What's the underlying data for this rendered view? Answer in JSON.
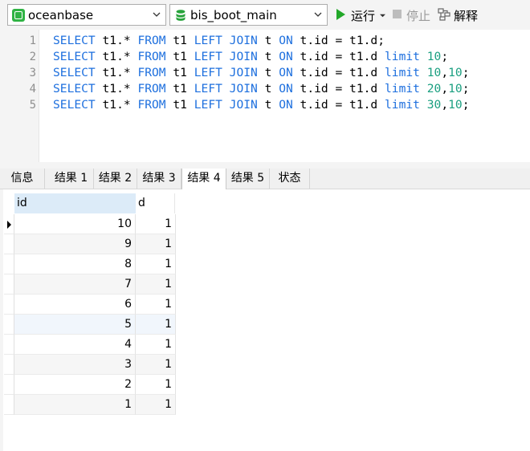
{
  "toolbar": {
    "connection": "oceanbase",
    "database": "bis_boot_main",
    "run_label": "运行",
    "stop_label": "停止",
    "explain_label": "解释"
  },
  "editor": {
    "line_numbers": [
      "1",
      "2",
      "3",
      "4",
      "5"
    ]
  },
  "tabs": [
    "信息",
    "结果 1",
    "结果 2",
    "结果 3",
    "结果 4",
    "结果 5",
    "状态"
  ],
  "active_tab": "结果 4",
  "grid": {
    "columns": [
      "id",
      "d"
    ],
    "rows": [
      [
        "10",
        "1"
      ],
      [
        "9",
        "1"
      ],
      [
        "8",
        "1"
      ],
      [
        "7",
        "1"
      ],
      [
        "6",
        "1"
      ],
      [
        "5",
        "1"
      ],
      [
        "4",
        "1"
      ],
      [
        "3",
        "1"
      ],
      [
        "2",
        "1"
      ],
      [
        "1",
        "1"
      ]
    ]
  },
  "colors": {
    "keyword": "#1d6fde",
    "number": "#1a9f80",
    "run": "#22a829"
  }
}
